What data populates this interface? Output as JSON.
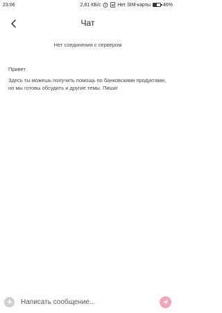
{
  "status_bar": {
    "time": "23:06",
    "speed": "2,81 КБ/с",
    "sim_status": "Нет SIM-карты",
    "battery_percent": "46%",
    "battery_level": 0.46
  },
  "header": {
    "title": "Чат",
    "back_icon": "chevron-left-icon"
  },
  "connection": {
    "status": "Нет соединения с сервером"
  },
  "message": {
    "greeting": "Привет",
    "text": "Здесь ты можешь получить помощь по банковскими продуктами, но мы готовы обсудить и другие темы. Пиши!"
  },
  "composer": {
    "placeholder": "Написать сообщение...",
    "value": "",
    "add_icon": "plus-icon",
    "send_icon": "send-icon",
    "send_color": "#f3a5b5"
  },
  "colors": {
    "background": "#ffffff",
    "text": "#444444"
  }
}
